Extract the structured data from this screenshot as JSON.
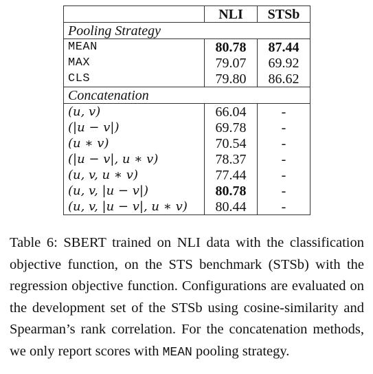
{
  "table": {
    "columns": [
      "",
      "NLI",
      "STSb"
    ],
    "sections": [
      {
        "title": "Pooling Strategy",
        "rows": [
          {
            "label": "MEAN",
            "nli": "80.78",
            "stsb": "87.44",
            "nli_bold": true,
            "stsb_bold": true
          },
          {
            "label": "MAX",
            "nli": "79.07",
            "stsb": "69.92"
          },
          {
            "label": "CLS",
            "nli": "79.80",
            "stsb": "86.62"
          }
        ]
      },
      {
        "title": "Concatenation",
        "rows": [
          {
            "label": "(u, v)",
            "nli": "66.04",
            "stsb": "-"
          },
          {
            "label": "(|u − v|)",
            "nli": "69.78",
            "stsb": "-"
          },
          {
            "label": "(u ∗ v)",
            "nli": "70.54",
            "stsb": "-"
          },
          {
            "label": "(|u − v|, u ∗ v)",
            "nli": "78.37",
            "stsb": "-"
          },
          {
            "label": "(u, v, u ∗ v)",
            "nli": "77.44",
            "stsb": "-"
          },
          {
            "label": "(u, v, |u − v|)",
            "nli": "80.78",
            "stsb": "-",
            "nli_bold": true
          },
          {
            "label": "(u, v, |u − v|, u ∗ v)",
            "nli": "80.44",
            "stsb": "-"
          }
        ]
      }
    ]
  },
  "caption": {
    "prefix": "Table 6: SBERT trained on NLI data with the classification objective function, on the STS benchmark (STSb) with the regression objective function. Configurations are evaluated on the development set of the STSb using cosine-similarity and Spearman’s rank correlation. For the concatenation methods, we only report scores with",
    "mono_word": "MEAN",
    "suffix": "pooling strategy."
  }
}
